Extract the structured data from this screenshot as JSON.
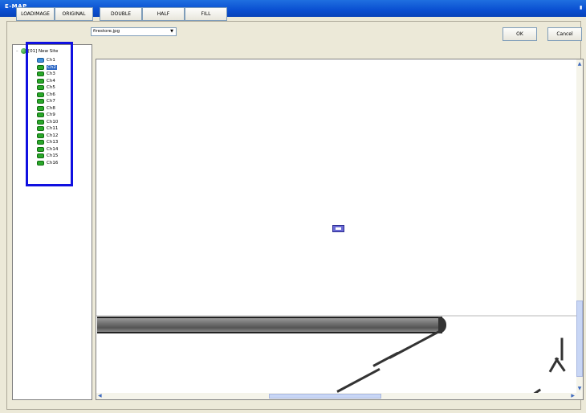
{
  "window": {
    "title": "E-MAP"
  },
  "toolbar": {
    "loadimage": "LOADIMAGE",
    "original": "ORIGINAL",
    "double": "DOUBLE",
    "half": "HALF",
    "fill": "FILL",
    "ok": "OK",
    "cancel": "Cancel"
  },
  "image_select": {
    "value": "firestore.jpg"
  },
  "tree": {
    "root_label": "[01] New Site",
    "channels": [
      {
        "label": "Ch1",
        "selected": false,
        "icon": "blue"
      },
      {
        "label": "Ch2",
        "selected": true,
        "icon": "green"
      },
      {
        "label": "Ch3",
        "selected": false,
        "icon": "green"
      },
      {
        "label": "Ch4",
        "selected": false,
        "icon": "green"
      },
      {
        "label": "Ch5",
        "selected": false,
        "icon": "green"
      },
      {
        "label": "Ch6",
        "selected": false,
        "icon": "green"
      },
      {
        "label": "Ch7",
        "selected": false,
        "icon": "green"
      },
      {
        "label": "Ch8",
        "selected": false,
        "icon": "green"
      },
      {
        "label": "Ch9",
        "selected": false,
        "icon": "green"
      },
      {
        "label": "Ch10",
        "selected": false,
        "icon": "green"
      },
      {
        "label": "Ch11",
        "selected": false,
        "icon": "green"
      },
      {
        "label": "Ch12",
        "selected": false,
        "icon": "green"
      },
      {
        "label": "Ch13",
        "selected": false,
        "icon": "green"
      },
      {
        "label": "Ch14",
        "selected": false,
        "icon": "green"
      },
      {
        "label": "Ch15",
        "selected": false,
        "icon": "green"
      },
      {
        "label": "Ch16",
        "selected": false,
        "icon": "green"
      }
    ]
  },
  "colors": {
    "titlebar": "#0a4fd1",
    "highlight": "#1010e0",
    "selection": "#316ac5",
    "camera": "#2aa82a"
  }
}
